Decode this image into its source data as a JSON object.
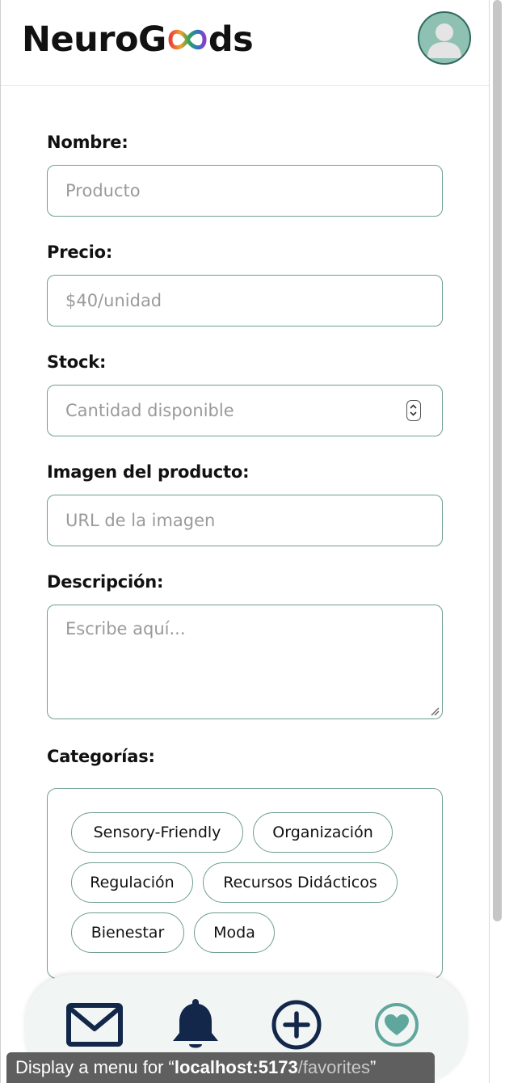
{
  "header": {
    "logo_prefix": "NeuroG",
    "logo_suffix": "ds"
  },
  "form": {
    "name_label": "Nombre:",
    "name_placeholder": "Producto",
    "price_label": "Precio:",
    "price_placeholder": "$40/unidad",
    "stock_label": "Stock:",
    "stock_placeholder": "Cantidad disponible",
    "image_label": "Imagen del producto:",
    "image_placeholder": "URL de la imagen",
    "description_label": "Descripción:",
    "description_placeholder": "Escribe aquí...",
    "categories_label": "Categorías:"
  },
  "categories": [
    "Sensory-Friendly",
    "Organización",
    "Regulación",
    "Recursos Didácticos",
    "Bienestar",
    "Moda"
  ],
  "bottom_nav": {
    "icons": [
      "mail-icon",
      "bell-icon",
      "add-circle-icon",
      "heart-circle-icon"
    ]
  },
  "tooltip": {
    "prefix": "Display a menu for “",
    "host": "localhost:5173",
    "path": "/favorites",
    "suffix": "”"
  },
  "colors": {
    "accent": "#6f9e92",
    "avatar_bg": "#8fc1b3",
    "nav_dark": "#13274a",
    "nav_teal": "#5fa79c",
    "nav_bar_bg": "#f1f5f4"
  }
}
